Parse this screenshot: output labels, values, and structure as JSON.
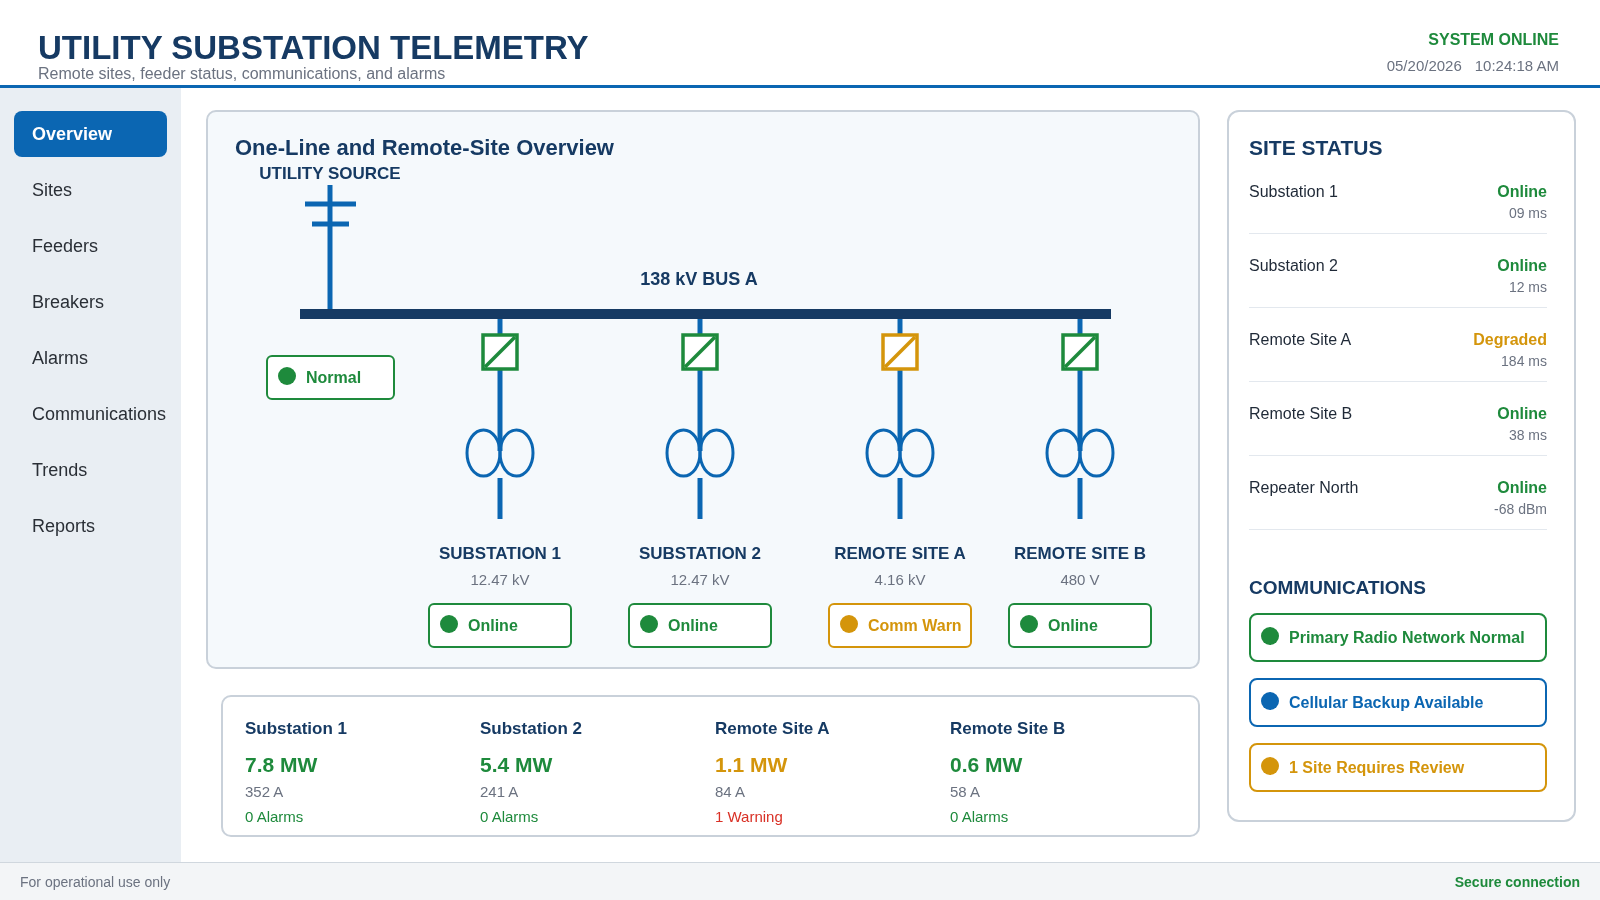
{
  "header": {
    "title": "UTILITY SUBSTATION TELEMETRY",
    "subtitle": "Remote sites, feeder status, communications, and alarms",
    "system_status": "SYSTEM ONLINE",
    "date": "05/20/2026",
    "time": "10:24:18 AM"
  },
  "sidebar": {
    "items": [
      {
        "label": "Overview",
        "selected": true
      },
      {
        "label": "Sites",
        "selected": false
      },
      {
        "label": "Feeders",
        "selected": false
      },
      {
        "label": "Breakers",
        "selected": false
      },
      {
        "label": "Alarms",
        "selected": false
      },
      {
        "label": "Communications",
        "selected": false
      },
      {
        "label": "Trends",
        "selected": false
      },
      {
        "label": "Reports",
        "selected": false
      }
    ]
  },
  "diagram": {
    "title": "One-Line and Remote-Site Overview",
    "source": {
      "label": "UTILITY SOURCE",
      "status": "Normal",
      "color": "#1e8a3c"
    },
    "bus_label": "138 kV BUS A",
    "feeders": [
      {
        "name": "SUBSTATION 1",
        "voltage": "12.47 kV",
        "status": "Online",
        "color": "#1e8a3c"
      },
      {
        "name": "SUBSTATION 2",
        "voltage": "12.47 kV",
        "status": "Online",
        "color": "#1e8a3c"
      },
      {
        "name": "REMOTE SITE A",
        "voltage": "4.16 kV",
        "status": "Comm Warn",
        "color": "#d4950b"
      },
      {
        "name": "REMOTE SITE B",
        "voltage": "480 V",
        "status": "Online",
        "color": "#1e8a3c"
      }
    ]
  },
  "summary": {
    "items": [
      {
        "name": "Substation 1",
        "power": "7.8 MW",
        "current": "352 A",
        "alarms": "0 Alarms",
        "warning": false
      },
      {
        "name": "Substation 2",
        "power": "5.4 MW",
        "current": "241 A",
        "alarms": "0 Alarms",
        "warning": false
      },
      {
        "name": "Remote Site A",
        "power": "1.1 MW",
        "current": "84 A",
        "alarms": "1 Warning",
        "warning": true
      },
      {
        "name": "Remote Site B",
        "power": "0.6 MW",
        "current": "58 A",
        "alarms": "0 Alarms",
        "warning": false
      }
    ]
  },
  "site_status": {
    "title": "SITE STATUS",
    "rows": [
      {
        "name": "Substation 1",
        "status": "Online",
        "reading": "09 ms",
        "color": "#1e8a3c"
      },
      {
        "name": "Substation 2",
        "status": "Online",
        "reading": "12 ms",
        "color": "#1e8a3c"
      },
      {
        "name": "Remote Site A",
        "status": "Degraded",
        "reading": "184 ms",
        "color": "#d4950b"
      },
      {
        "name": "Remote Site B",
        "status": "Online",
        "reading": "38 ms",
        "color": "#1e8a3c"
      },
      {
        "name": "Repeater North",
        "status": "Online",
        "reading": "-68 dBm",
        "color": "#1e8a3c"
      }
    ]
  },
  "communications": {
    "title": "COMMUNICATIONS",
    "items": [
      {
        "label": "Primary Radio Network Normal",
        "color": "#1e8a3c"
      },
      {
        "label": "Cellular Backup Available",
        "color": "#0b66b2"
      },
      {
        "label": "1 Site Requires Review",
        "color": "#d4950b"
      }
    ]
  },
  "footer": {
    "note": "For operational use only",
    "connection": "Secure connection"
  }
}
